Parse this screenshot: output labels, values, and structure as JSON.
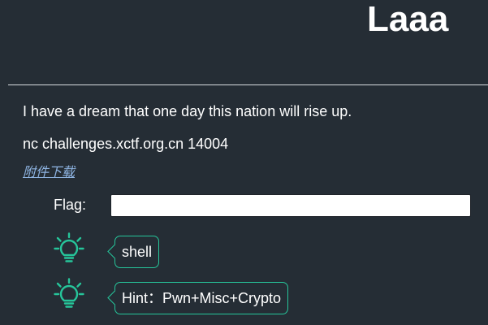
{
  "challenge": {
    "title": "Laaa",
    "description": "I have a dream that one day this nation will rise up.",
    "connection": "nc challenges.xctf.org.cn 14004",
    "attachment_link": "附件下载"
  },
  "flag_form": {
    "label": "Flag:",
    "value": "",
    "placeholder": ""
  },
  "hints": [
    {
      "icon": "lightbulb-icon",
      "text": "shell"
    },
    {
      "icon": "lightbulb-icon",
      "text": "Hint：Pwn+Misc+Crypto"
    }
  ],
  "colors": {
    "background": "#252d35",
    "accent": "#26c59a",
    "link": "#8fb5e3",
    "text": "#ffffff"
  }
}
